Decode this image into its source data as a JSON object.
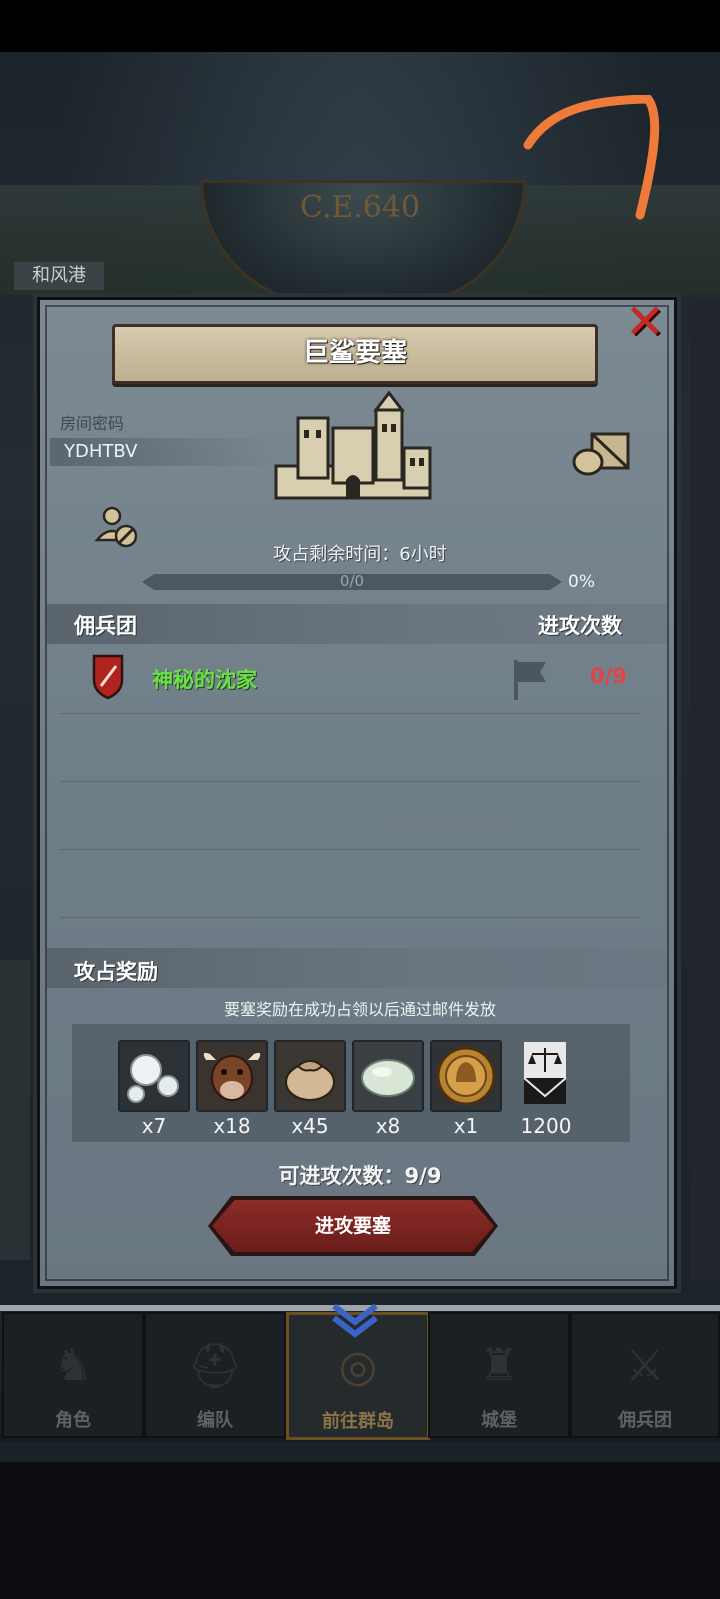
{
  "era": "C.E.640",
  "harbor": "和风港",
  "dialog": {
    "title": "巨鲨要塞",
    "room_password_label": "房间密码",
    "room_password": "YDHTBV",
    "time_remaining": "攻占剩余时间：6小时",
    "progress_text": "0/0",
    "progress_percent": "0%",
    "progress_value": 0,
    "merc_header": "佣兵团",
    "attack_count_header": "进攻次数",
    "mercenaries": [
      {
        "name": "神秘的沈家",
        "attacks": "0/9"
      }
    ],
    "reward_header": "攻占奖励",
    "reward_note": "要塞奖励在成功占领以后通过邮件发放",
    "rewards": [
      {
        "icon": "pearl-icon",
        "qty": "x7"
      },
      {
        "icon": "cow-icon",
        "qty": "x18"
      },
      {
        "icon": "sack-icon",
        "qty": "x45"
      },
      {
        "icon": "stone-icon",
        "qty": "x8"
      },
      {
        "icon": "helmet-coin-icon",
        "qty": "x1"
      },
      {
        "icon": "scales-banner-icon",
        "qty": "1200"
      }
    ],
    "remaining_attacks": "可进攻次数：9/9",
    "attack_button": "进攻要塞"
  },
  "nav": {
    "items": [
      {
        "label": "角色"
      },
      {
        "label": "编队"
      },
      {
        "label": "前往群岛",
        "active": true
      },
      {
        "label": "城堡"
      },
      {
        "label": "佣兵团"
      }
    ]
  },
  "colors": {
    "merc_name": "#69e04a",
    "attack_count": "#e04444",
    "close": "#c62a22",
    "attack_button": "#8c2c28"
  }
}
